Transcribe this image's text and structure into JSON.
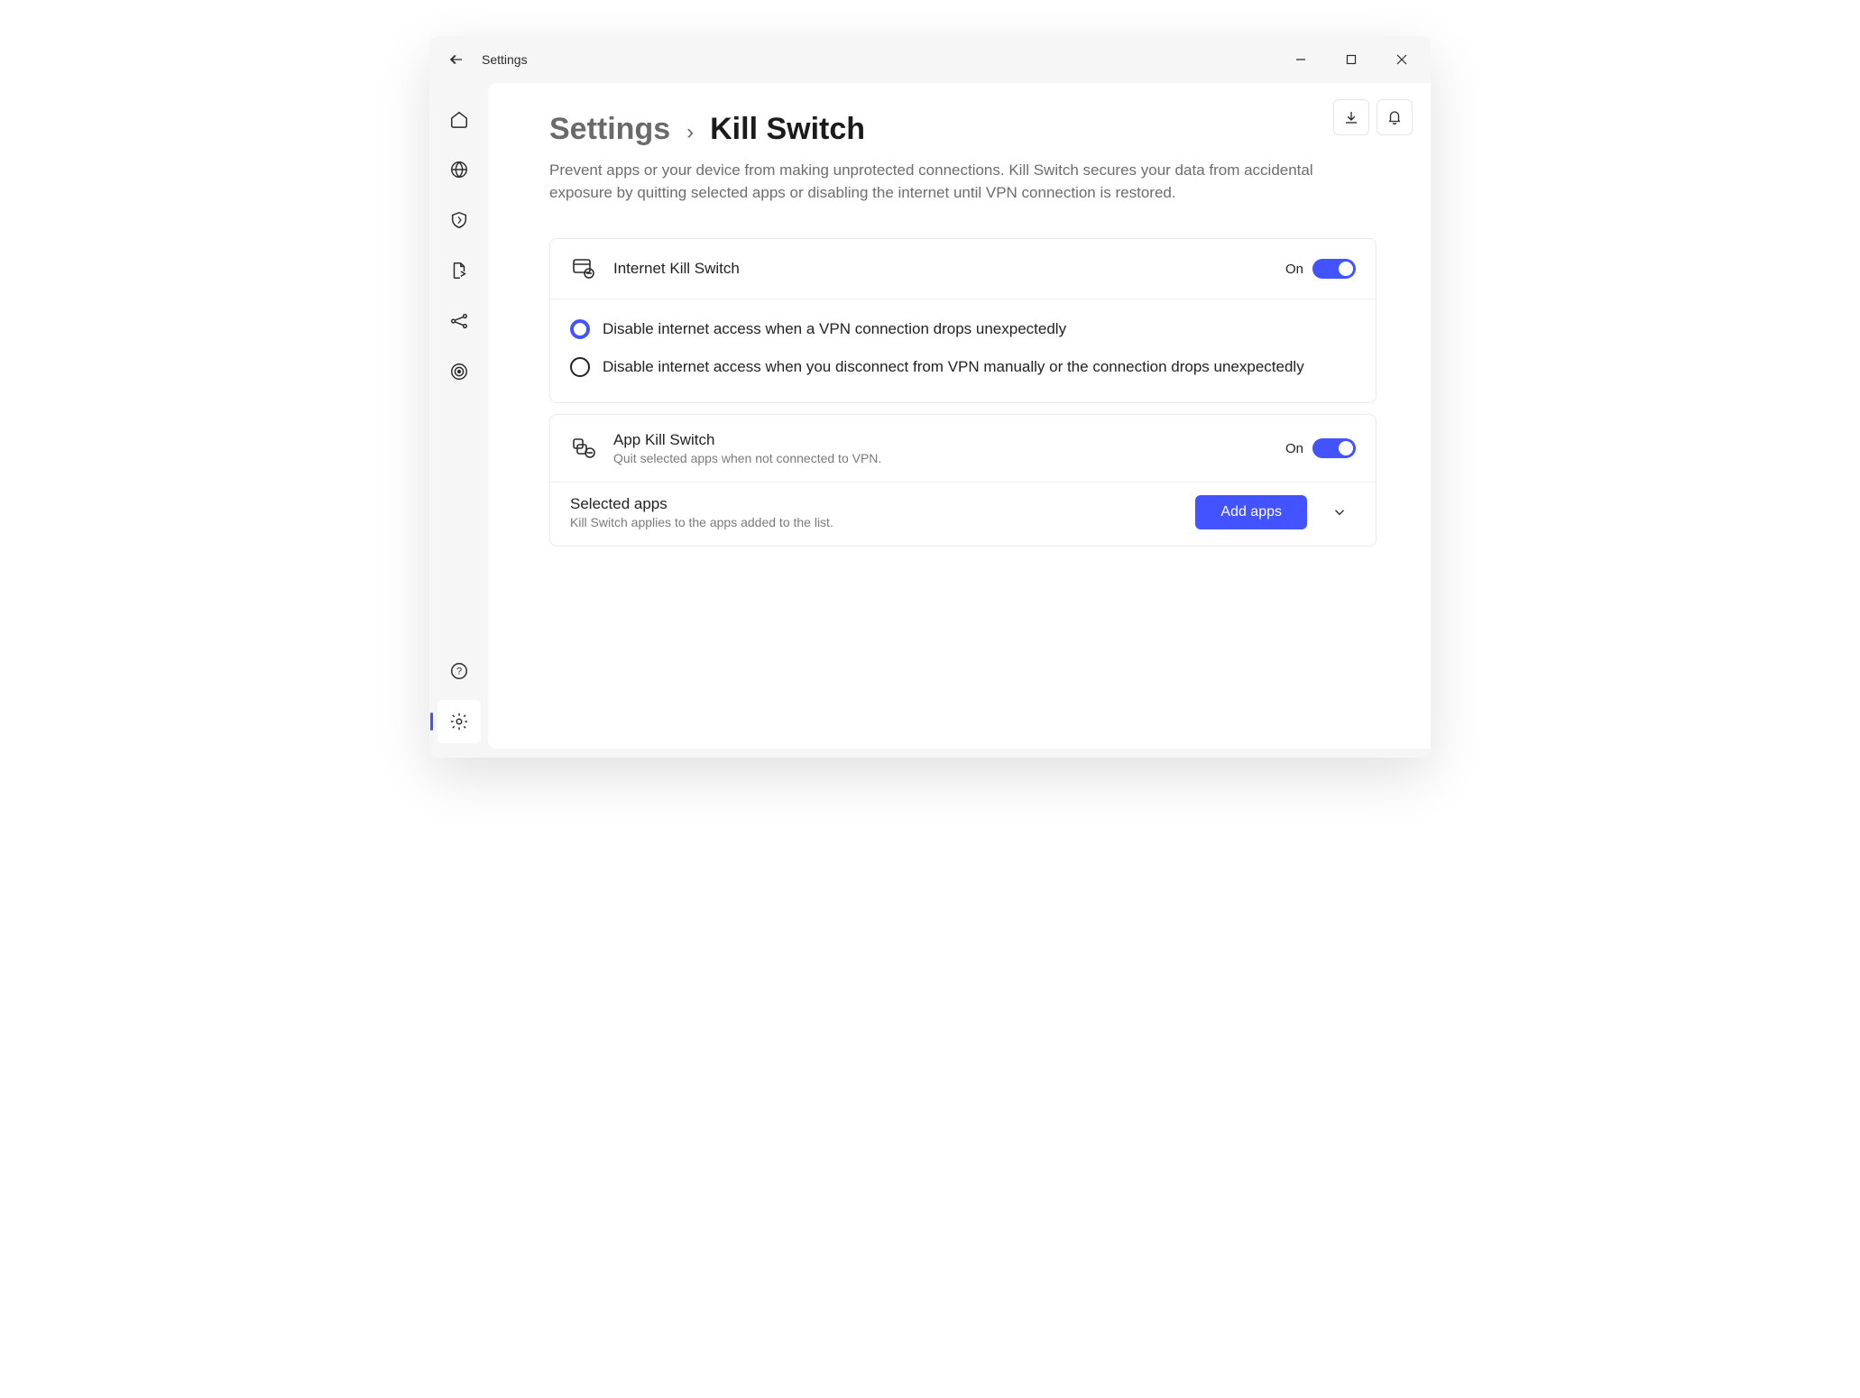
{
  "window": {
    "title": "Settings"
  },
  "breadcrumb": {
    "root": "Settings",
    "separator": "›",
    "current": "Kill Switch"
  },
  "page": {
    "description": "Prevent apps or your device from making unprotected connections. Kill Switch secures your data from accidental exposure by quitting selected apps or disabling the internet until VPN connection is restored."
  },
  "internet_kill_switch": {
    "title": "Internet Kill Switch",
    "state_label": "On",
    "enabled": true,
    "options": [
      {
        "label": "Disable internet access when a VPN connection drops unexpectedly",
        "selected": true
      },
      {
        "label": "Disable internet access when you disconnect from VPN manually or the connection drops unexpectedly",
        "selected": false
      }
    ]
  },
  "app_kill_switch": {
    "title": "App Kill Switch",
    "subtitle": "Quit selected apps when not connected to VPN.",
    "state_label": "On",
    "enabled": true,
    "selected_apps": {
      "title": "Selected apps",
      "subtitle": "Kill Switch applies to the apps added to the list.",
      "button_label": "Add apps"
    }
  },
  "sidebar": {
    "items": [
      {
        "name": "home"
      },
      {
        "name": "globe"
      },
      {
        "name": "shield"
      },
      {
        "name": "file-share"
      },
      {
        "name": "mesh"
      },
      {
        "name": "target"
      }
    ],
    "footer_items": [
      {
        "name": "help"
      },
      {
        "name": "settings",
        "active": true
      }
    ]
  }
}
